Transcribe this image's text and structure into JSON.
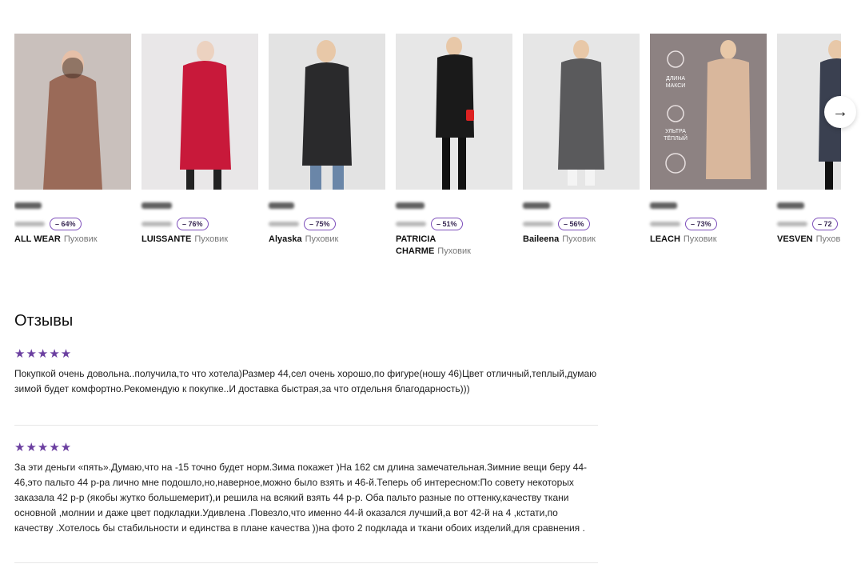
{
  "products": [
    {
      "brand": "ALL WEAR",
      "category": "Пуховик",
      "discount": "– 64%",
      "bg": "#c9c0bc",
      "coat": "#9a6a58"
    },
    {
      "brand": "LUISSANTE",
      "category": "Пуховик",
      "discount": "– 76%",
      "bg": "#e9e7e8",
      "coat": "#c8193a"
    },
    {
      "brand": "Alyaska",
      "category": "Пуховик",
      "discount": "– 75%",
      "bg": "#e3e3e3",
      "coat": "#2a2a2c"
    },
    {
      "brand": "PATRICIA CHARME",
      "category": "Пуховик",
      "discount": "– 51%",
      "bg": "#e7e7e7",
      "coat": "#1a1a1a"
    },
    {
      "brand": "Baileena",
      "category": "Пуховик",
      "discount": "– 56%",
      "bg": "#e6e6e6",
      "coat": "#5a5a5c"
    },
    {
      "brand": "LEACH",
      "category": "Пуховик",
      "discount": "– 73%",
      "bg": "#8d8282",
      "coat": "#d9b79c",
      "promo": [
        "ДЛИНА",
        "МАКСИ",
        "УЛЬТРА",
        "ТЁПЛЫЙ"
      ]
    },
    {
      "brand": "VESVEN",
      "category": "Пуховик",
      "discount": "– 72",
      "bg": "#e5e5e5",
      "coat": "#3a4050"
    }
  ],
  "carousel": {
    "next_icon": "→"
  },
  "reviews": {
    "title": "Отзывы",
    "items": [
      {
        "stars": "★★★★★",
        "text": "Покупкой очень довольна..получила,то что хотела)Размер 44,сел очень хорошо,по фигуре(ношу 46)Цвет отличный,теплый,думаю зимой будет комфортно.Рекомендую к покупке..И доставка быстрая,за что отдельня благодарность)))"
      },
      {
        "stars": "★★★★★",
        "text": "За эти деньги «пять».Думаю,что на -15 точно будет норм.Зима покажет )На 162 см длина замечательная.Зимние вещи беру 44-46,это пальто 44 р-ра лично мне подошло,но,наверное,можно было взять и 46-й.Теперь об интересном:По совету некоторых заказала 42 р-р (якобы жутко большемерит),и решила на всякий взять 44 р-р. Оба пальто разные по оттенку,качеству ткани основной ,молнии и даже цвет подкладки.Удивлена .Повезло,что именно 44-й оказался лучший,а вот 42-й на 4 ,кстати,по качеству .Хотелось бы стабильности и единства в плане качества ))на фото 2 подклада и ткани обоих изделий,для сравнения ."
      }
    ]
  },
  "colors": {
    "accent": "#6b3fa0",
    "badge_border": "#7c4dba"
  }
}
